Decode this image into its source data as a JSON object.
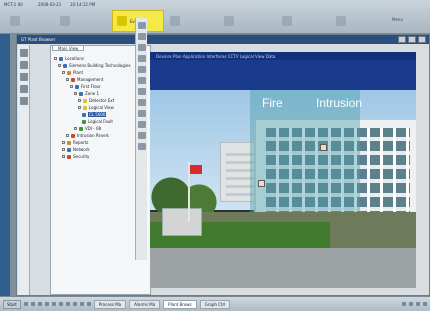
{
  "topbar": {
    "status_left": "MCT-1 00",
    "status_date": "2008-03-21",
    "status_time": "10:14:12 PM",
    "buttons": [
      {
        "label": ""
      },
      {
        "label": ""
      },
      {
        "label": "Event",
        "active": true
      },
      {
        "label": ""
      },
      {
        "label": ""
      },
      {
        "label": ""
      },
      {
        "label": ""
      }
    ],
    "menu_label": "Menu"
  },
  "window": {
    "title": "GT Plant Browser"
  },
  "tree": {
    "tab_label": "Main View",
    "nodes": [
      {
        "label": "Locations"
      },
      {
        "label": "Siemens Building Technologies"
      },
      {
        "label": "Plant"
      },
      {
        "label": "Management"
      },
      {
        "label": "First Floor"
      },
      {
        "label": "Zone 1"
      },
      {
        "label": "Detector Ext"
      },
      {
        "label": "Logical View"
      },
      {
        "label": "CL 5000",
        "selected": true
      },
      {
        "label": "Logical Fault"
      },
      {
        "label": "VDI - 08"
      },
      {
        "label": "Intrusion Panels"
      },
      {
        "label": "Reports"
      },
      {
        "label": "Network"
      },
      {
        "label": "Security"
      }
    ]
  },
  "canvas": {
    "menu_items": "Devices  Plan  Application  Interfaces  CCTV  Logical View  Data",
    "label_fire": "Fire",
    "label_intrusion": "Intrusion"
  },
  "taskbar": {
    "start": "Start",
    "items": [
      {
        "label": "Process Ma"
      },
      {
        "label": "Alarms Ma"
      },
      {
        "label": "Plant Brows",
        "active": true
      },
      {
        "label": "Graph Ctrl"
      }
    ]
  }
}
